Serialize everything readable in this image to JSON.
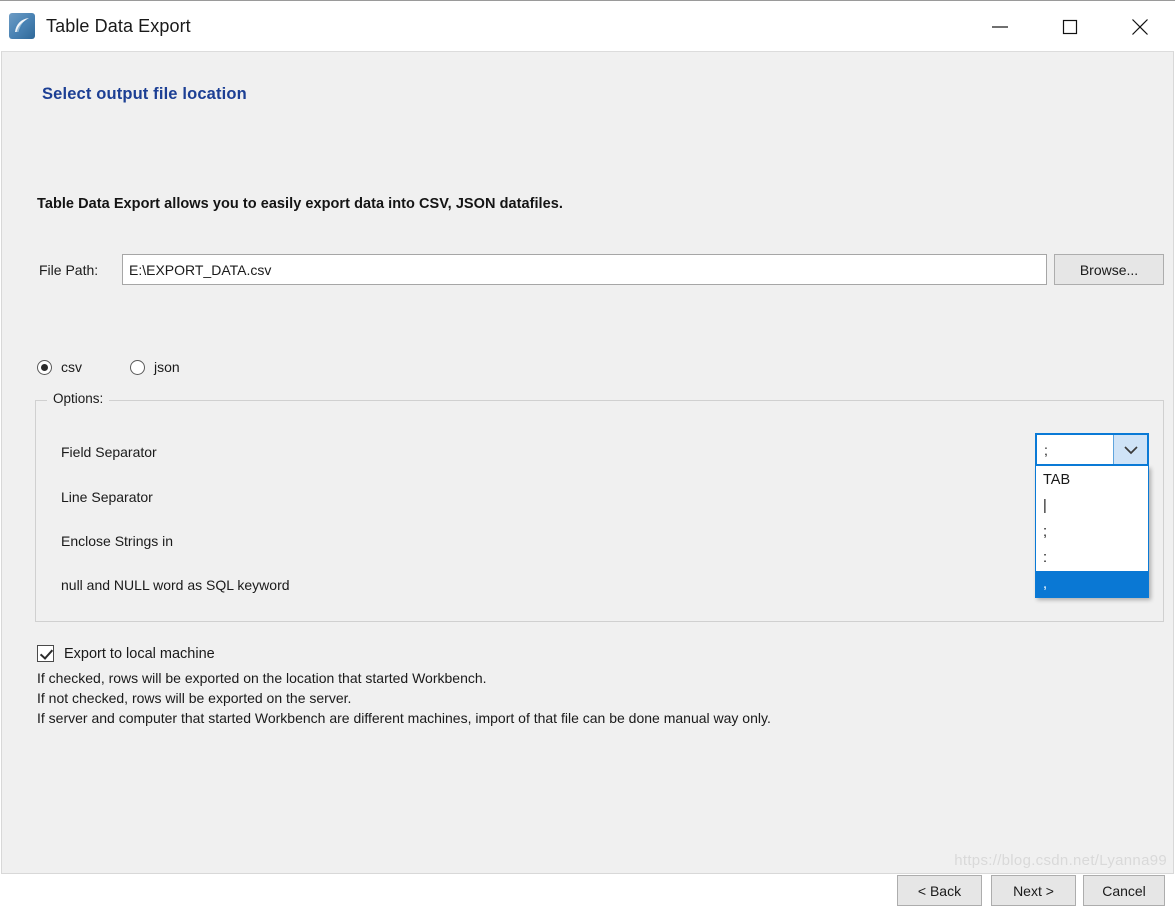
{
  "window": {
    "title": "Table Data Export",
    "icon": "workbench-dolphin-icon",
    "controls": {
      "minimize": "minimize-icon",
      "maximize": "maximize-icon",
      "close": "close-icon"
    }
  },
  "page": {
    "heading": "Select output file location",
    "heading_color": "#1c3f94",
    "intro": "Table Data Export allows you to easily export data into CSV, JSON datafiles."
  },
  "file_path": {
    "label": "File Path:",
    "value": "E:\\EXPORT_DATA.csv",
    "placeholder": "",
    "browse_label": "Browse..."
  },
  "format": {
    "options": [
      {
        "label": "csv",
        "selected": true
      },
      {
        "label": "json",
        "selected": false
      }
    ]
  },
  "options_group": {
    "legend": "Options:",
    "rows": [
      {
        "label": "Field Separator"
      },
      {
        "label": "Line Separator"
      },
      {
        "label": "Enclose Strings in"
      },
      {
        "label": "null and NULL word as SQL keyword"
      }
    ]
  },
  "field_separator_combo": {
    "value": ";",
    "expanded": true,
    "arrow_icon": "chevron-down-icon",
    "items": [
      {
        "label": "TAB",
        "selected": false
      },
      {
        "label": "|",
        "selected": false
      },
      {
        "label": ";",
        "selected": false
      },
      {
        "label": ":",
        "selected": false
      },
      {
        "label": ",",
        "selected": true
      }
    ],
    "highlight_color": "#0a78d4",
    "focus_border_color": "#0a7ad6"
  },
  "export_local": {
    "checkbox_label": "Export to local machine",
    "checked": true,
    "notes": [
      "If checked, rows will be exported on the location that started Workbench.",
      "If not checked, rows will be exported on the server.",
      "If server and computer that started Workbench are different machines, import of that file can be done manual way only."
    ]
  },
  "footer": {
    "back_label": "< Back",
    "next_label": "Next >",
    "cancel_label": "Cancel"
  },
  "watermark": "https://blog.csdn.net/Lyanna99"
}
